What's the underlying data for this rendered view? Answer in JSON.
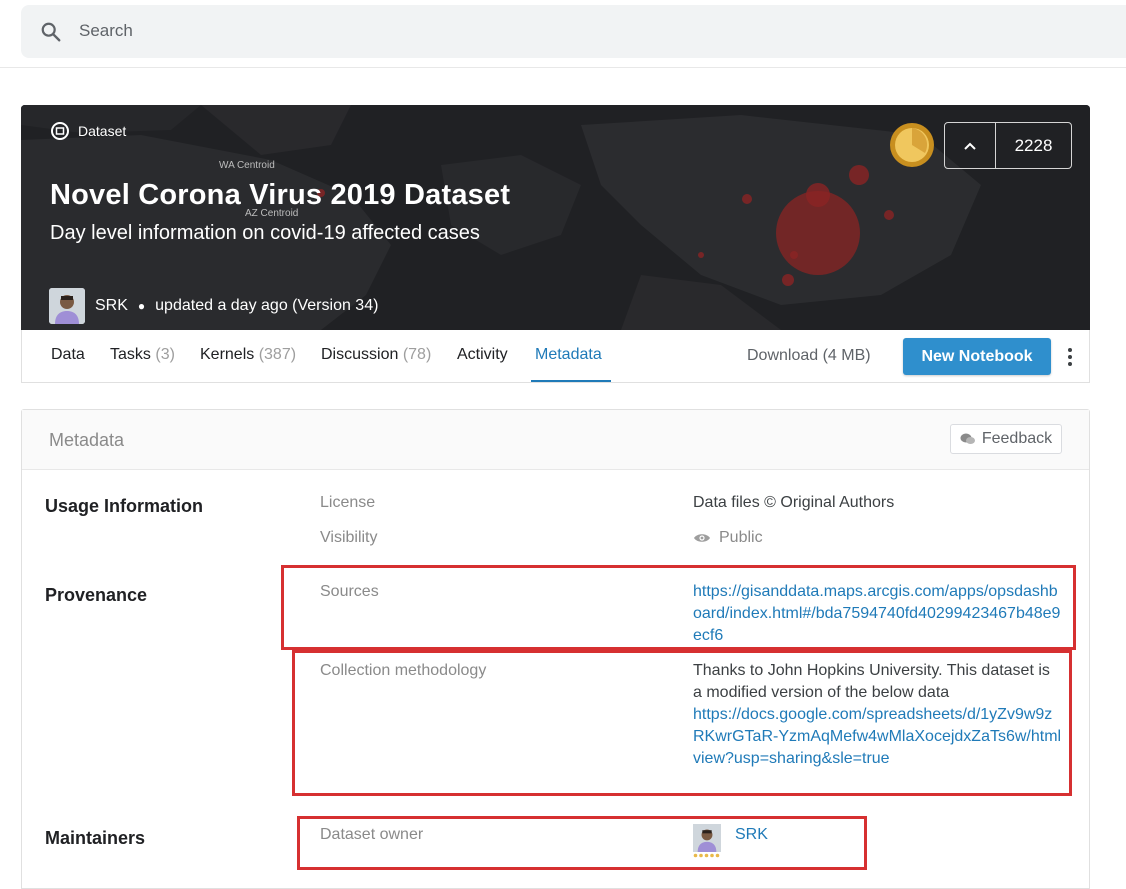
{
  "search": {
    "placeholder": "Search"
  },
  "hero": {
    "badge": "Dataset",
    "map_labels": [
      "WA Centroid",
      "AZ Centroid"
    ],
    "title": "Novel Corona Virus 2019 Dataset",
    "subtitle": "Day level information on covid-19 affected cases",
    "author": "SRK",
    "updated": "updated a day ago (Version 34)",
    "vote_count": "2228"
  },
  "tabs": [
    {
      "label": "Data",
      "count": ""
    },
    {
      "label": "Tasks",
      "count": "(3)"
    },
    {
      "label": "Kernels",
      "count": "(387)"
    },
    {
      "label": "Discussion",
      "count": "(78)"
    },
    {
      "label": "Activity",
      "count": ""
    },
    {
      "label": "Metadata",
      "count": ""
    }
  ],
  "actions": {
    "download": "Download (4 MB)",
    "new_notebook": "New Notebook"
  },
  "metadata": {
    "title": "Metadata",
    "feedback": "Feedback",
    "usage": {
      "heading": "Usage Information",
      "license_label": "License",
      "license_value": "Data files © Original Authors",
      "visibility_label": "Visibility",
      "visibility_value": "Public"
    },
    "provenance": {
      "heading": "Provenance",
      "sources_label": "Sources",
      "sources_value": "https://gisanddata.maps.arcgis.com/apps/opsdashboard/index.html#/bda7594740fd40299423467b48e9ecf6",
      "method_label": "Collection methodology",
      "method_text": "Thanks to John Hopkins University. This dataset is a modified version of the below data",
      "method_link": "https://docs.google.com/spreadsheets/d/1yZv9w9zRKwrGTaR-YzmAqMefw4wMlaXocejdxZaTs6w/htmlview?usp=sharing&sle=true"
    },
    "maintainers": {
      "heading": "Maintainers",
      "owner_label": "Dataset owner",
      "owner_name": "SRK"
    }
  },
  "colors": {
    "accent": "#1f7ab8",
    "button": "#2f8fcd",
    "highlight": "#d63031",
    "medal": "#e9b949"
  }
}
